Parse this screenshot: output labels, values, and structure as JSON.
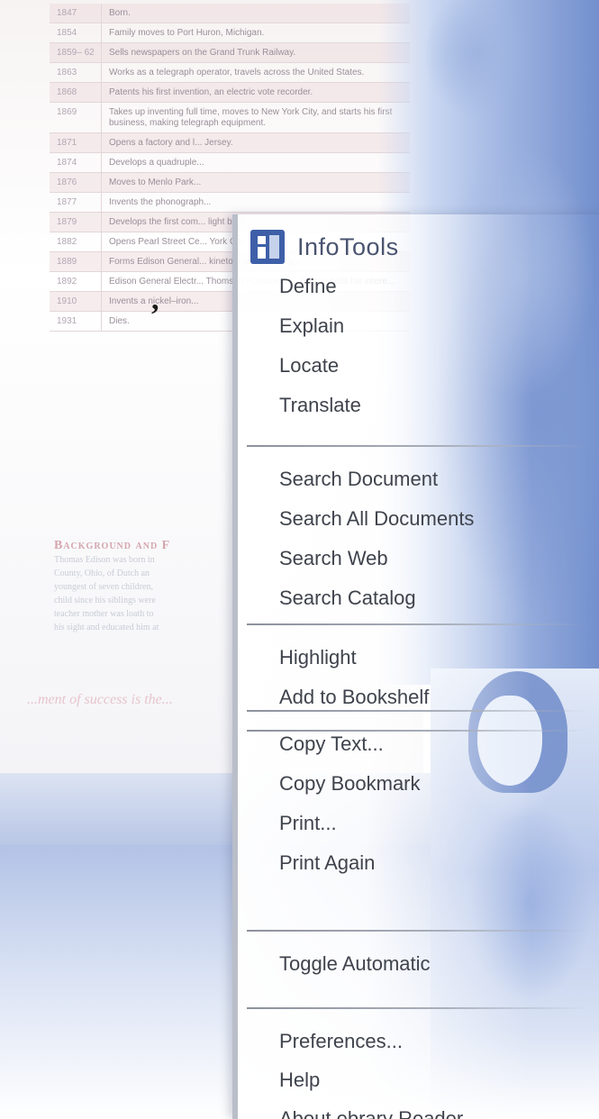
{
  "document": {
    "timeline": [
      {
        "year": "1847",
        "event": "Born."
      },
      {
        "year": "1854",
        "event": "Family moves to Port Huron, Michigan."
      },
      {
        "year": "1859–\n62",
        "event": "Sells newspapers on the Grand Trunk Railway."
      },
      {
        "year": "1863",
        "event": "Works as a telegraph operator, travels across the United States."
      },
      {
        "year": "1868",
        "event": "Patents his first invention, an electric vote recorder."
      },
      {
        "year": "1869",
        "event": "Takes up inventing full time, moves to New York City, and starts his first business, making telegraph equipment."
      },
      {
        "year": "1871",
        "event": "Opens a factory and l... Jersey."
      },
      {
        "year": "1874",
        "event": "Develops a quadruple..."
      },
      {
        "year": "1876",
        "event": "Moves to Menlo Park..."
      },
      {
        "year": "1877",
        "event": "Invents the phonograph..."
      },
      {
        "year": "1879",
        "event": "Develops the first com... light bulb."
      },
      {
        "year": "1882",
        "event": "Opens Pearl Street Ce... York City."
      },
      {
        "year": "1889",
        "event": "Forms Edison General... kinetograph (an early..."
      },
      {
        "year": "1892",
        "event": "Edison General Electr... Thomson-Houston to... Edison sells his intere..."
      },
      {
        "year": "1910",
        "event": "Invents a nickel–iron..."
      },
      {
        "year": "1931",
        "event": "Dies."
      }
    ],
    "section_heading": "Background and F",
    "paragraph_lines": [
      "Thomas Edison was born in",
      "County, Ohio, of Dutch an",
      "youngest of seven children,",
      "child since his siblings were",
      "teacher mother was loath to",
      "his sight and educated him at"
    ],
    "quote": "...ment of success is the..."
  },
  "infotools": {
    "title": "InfoTools",
    "icon": "infotools-app-icon",
    "groups": [
      [
        "Define",
        "Explain",
        "Locate",
        "Translate"
      ],
      [
        "Search Document",
        "Search All Documents",
        "Search Web",
        "Search Catalog"
      ],
      [
        "Highlight",
        "Add to Bookshelf"
      ],
      [
        "Copy Text...",
        "Copy Bookmark",
        "Print...",
        "Print Again"
      ],
      [
        "Toggle Automatic"
      ],
      [
        "Preferences...",
        "Help",
        "About ebrary Reader"
      ]
    ]
  }
}
